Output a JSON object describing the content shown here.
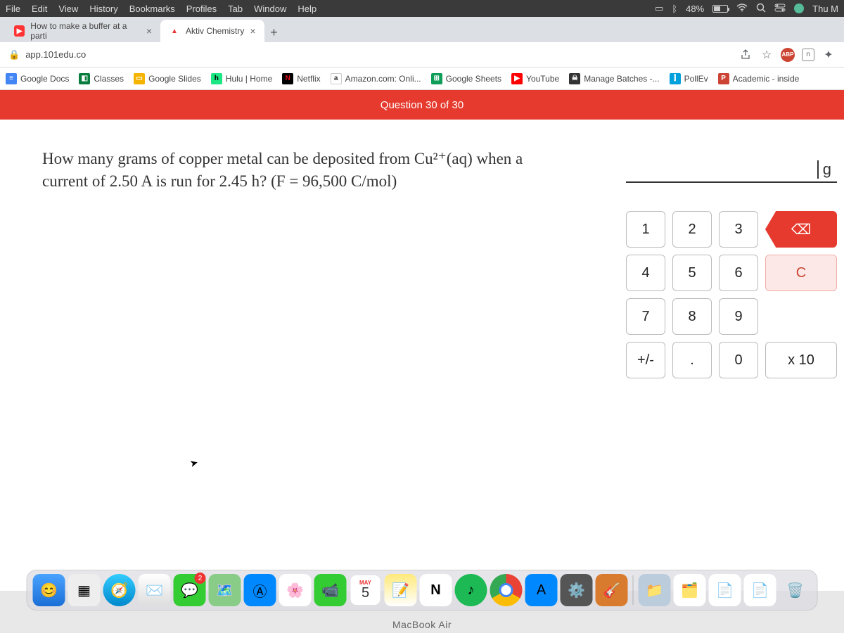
{
  "menubar": {
    "items": [
      "File",
      "Edit",
      "View",
      "History",
      "Bookmarks",
      "Profiles",
      "Tab",
      "Window",
      "Help"
    ],
    "battery_pct": "48%",
    "day": "Thu M"
  },
  "tabs": {
    "t0": {
      "title": "How to make a buffer at a parti"
    },
    "t1": {
      "title": "Aktiv Chemistry"
    }
  },
  "url": "app.101edu.co",
  "bookmarks": {
    "b0": "Google Docs",
    "b1": "Classes",
    "b2": "Google Slides",
    "b3": "Hulu | Home",
    "b4": "Netflix",
    "b5": "Amazon.com: Onli...",
    "b6": "Google Sheets",
    "b7": "YouTube",
    "b8": "Manage Batches -...",
    "b9": "PollEv",
    "b10": "Academic - inside"
  },
  "question_header": "Question 30 of 30",
  "question_text": "How many grams of copper metal can be deposited  from Cu²⁺(aq) when a current of 2.50 A is run for 2.45 h? (F = 96,500 C/mol)",
  "answer_unit": "g",
  "keypad": {
    "k1": "1",
    "k2": "2",
    "k3": "3",
    "k4": "4",
    "k5": "5",
    "k6": "6",
    "k7": "7",
    "k8": "8",
    "k9": "9",
    "plusminus": "+/-",
    "dot": ".",
    "k0": "0",
    "x10": "x 10",
    "back": "⌫",
    "clear": "C"
  },
  "dock": {
    "cal_month": "MAY",
    "cal_day": "5",
    "badge": "2"
  },
  "laptop": "MacBook Air",
  "abp": "ABP"
}
